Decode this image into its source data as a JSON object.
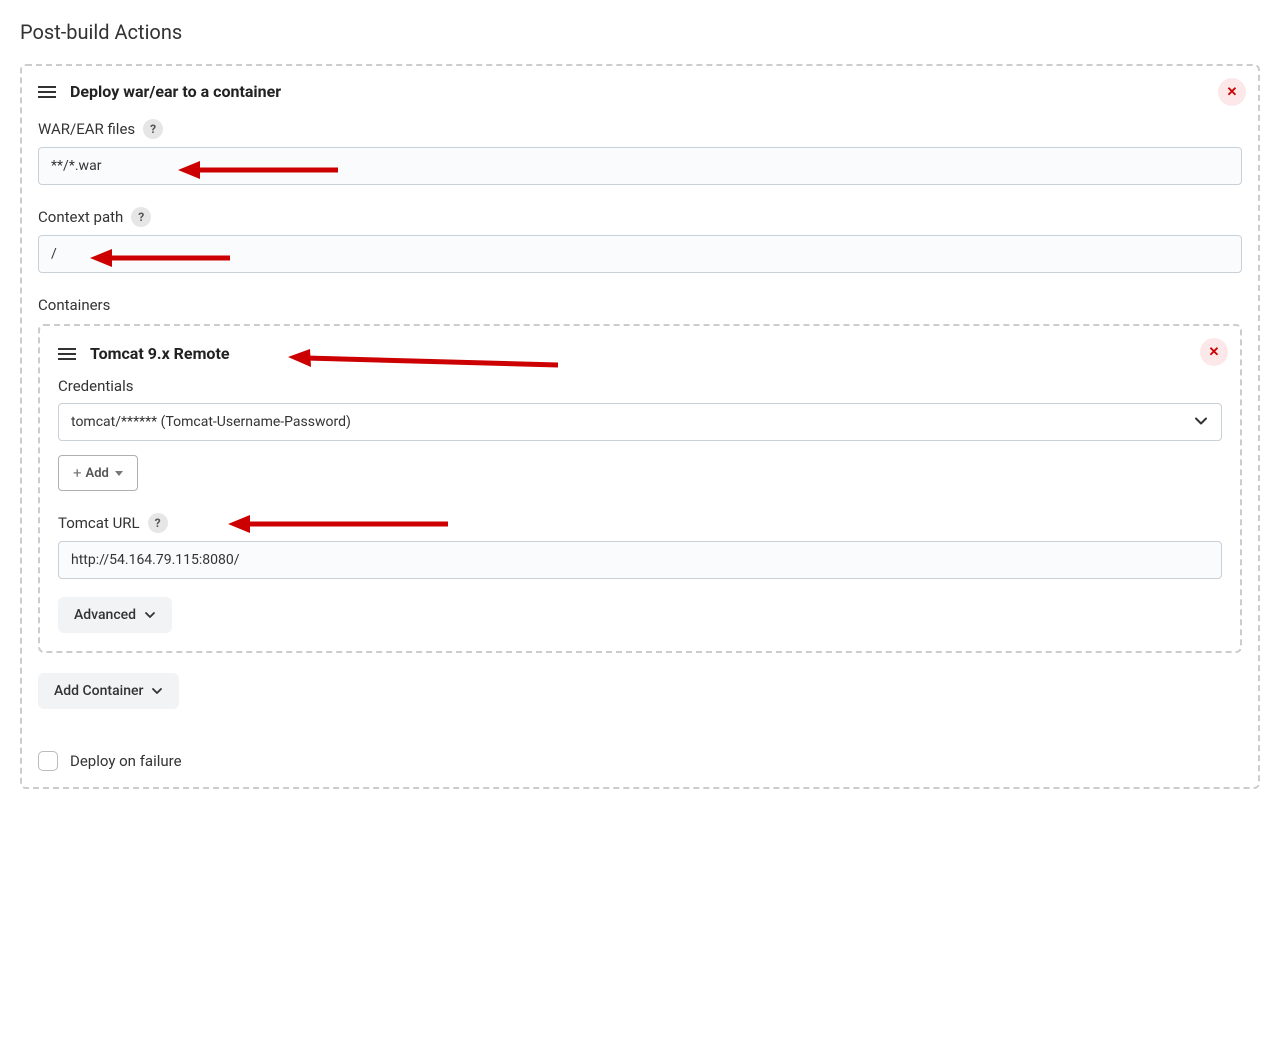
{
  "page": {
    "title": "Post-build Actions"
  },
  "deploy_section": {
    "title": "Deploy war/ear to a container",
    "war_files": {
      "label": "WAR/EAR files",
      "value": "**/*.war"
    },
    "context_path": {
      "label": "Context path",
      "value": "/"
    },
    "containers_label": "Containers",
    "container": {
      "title": "Tomcat 9.x Remote",
      "credentials": {
        "label": "Credentials",
        "selected": "tomcat/****** (Tomcat-Username-Password)"
      },
      "add_button": "Add",
      "tomcat_url": {
        "label": "Tomcat URL",
        "value": "http://54.164.79.115:8080/"
      },
      "advanced_button": "Advanced"
    },
    "add_container_button": "Add Container",
    "deploy_on_failure_label": "Deploy on failure"
  },
  "annotations": {
    "arrow_color": "#cc0000"
  }
}
